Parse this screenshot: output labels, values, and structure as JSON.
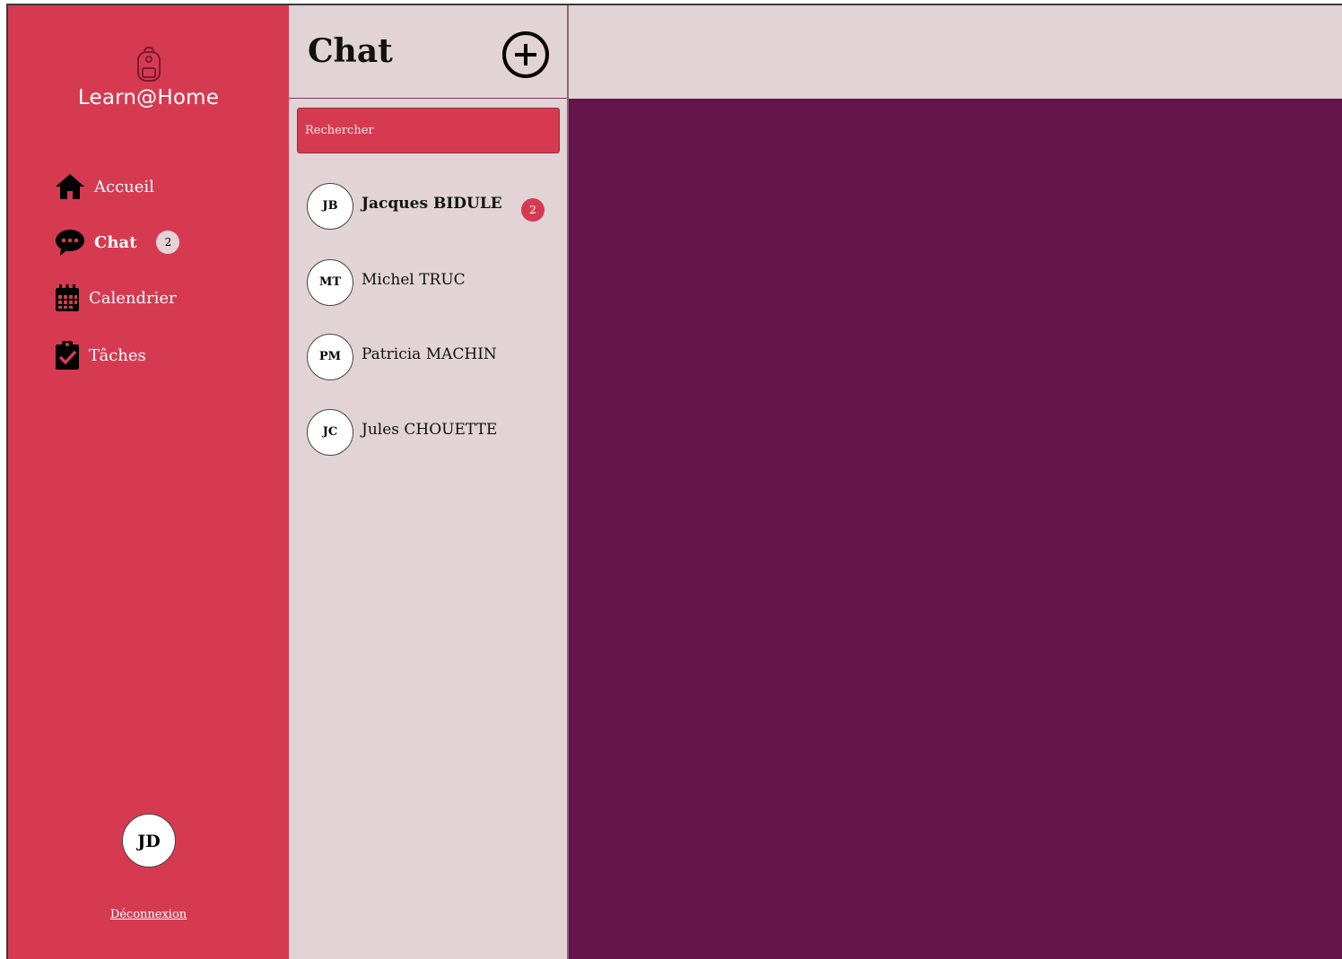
{
  "sidebar": {
    "brand": "Learn@Home",
    "brand_icon": "backpack-icon",
    "items": [
      {
        "label": "Accueil",
        "icon": "home-icon"
      },
      {
        "label": "Chat",
        "icon": "chat-bubble-icon",
        "badge": "2",
        "active": true
      },
      {
        "label": "Calendrier",
        "icon": "calendar-icon"
      },
      {
        "label": "Tâches",
        "icon": "clipboard-check-icon"
      }
    ],
    "user_initials": "JD",
    "logout_label": "Déconnexion"
  },
  "chat": {
    "title": "Chat",
    "add_icon": "plus-circle-icon",
    "search_placeholder": "Rechercher",
    "contacts": [
      {
        "initials": "JB",
        "name": "Jacques BIDULE",
        "unread": "2"
      },
      {
        "initials": "MT",
        "name": "Michel TRUC"
      },
      {
        "initials": "PM",
        "name": "Patricia MACHIN"
      },
      {
        "initials": "JC",
        "name": "Jules CHOUETTE"
      }
    ]
  },
  "colors": {
    "sidebar": "#d63a51",
    "panel": "#e1d3d6",
    "main": "#66154c"
  }
}
